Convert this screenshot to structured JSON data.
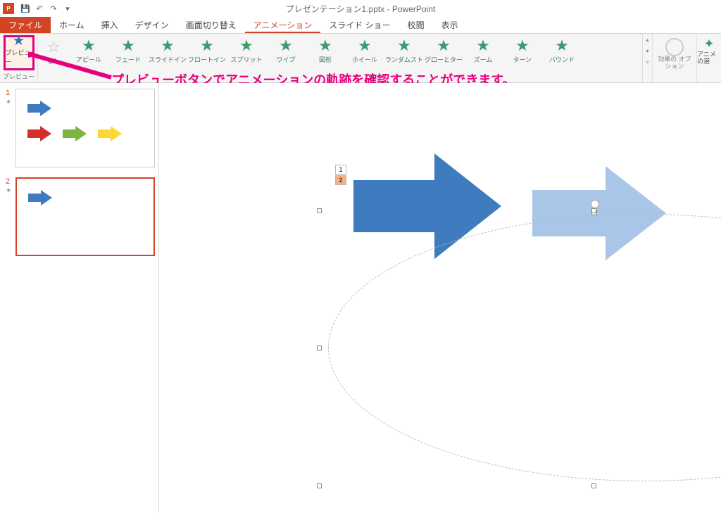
{
  "app": {
    "title": "プレゼンテーション1.pptx - PowerPoint",
    "app_abbrev": "P"
  },
  "qat": {
    "save_icon": "save-icon",
    "undo_icon": "undo-icon",
    "redo_icon": "redo-icon",
    "dropdown_icon": "chevron-down-icon"
  },
  "tabs": {
    "file": "ファイル",
    "home": "ホーム",
    "insert": "挿入",
    "design": "デザイン",
    "transitions": "画面切り替え",
    "animations": "アニメーション",
    "slideshow": "スライド ショー",
    "review": "校閲",
    "view": "表示"
  },
  "ribbon": {
    "preview_label": "プレビュー",
    "preview_group": "プレビュー",
    "none_label": "なし",
    "gallery": [
      {
        "label": "アピール"
      },
      {
        "label": "フェード"
      },
      {
        "label": "スライドイン"
      },
      {
        "label": "フロートイン"
      },
      {
        "label": "スプリット"
      },
      {
        "label": "ワイプ"
      },
      {
        "label": "図形"
      },
      {
        "label": "ホイール"
      },
      {
        "label": "ランダムスト…"
      },
      {
        "label": "グローとターン"
      },
      {
        "label": "ズーム"
      },
      {
        "label": "ターン"
      },
      {
        "label": "バウンド"
      }
    ],
    "effect_options": "効果の\nオプション",
    "anim_select": "アニメ\nの選"
  },
  "annotation": "プレビューボタンでアニメーションの軌跡を確認することができます。",
  "thumbnails": [
    {
      "num": "1",
      "has_anim": true,
      "selected": false
    },
    {
      "num": "2",
      "has_anim": true,
      "selected": true
    }
  ],
  "slide": {
    "tags": [
      "1",
      "2"
    ],
    "arrow1_color": "#3f7bbf",
    "arrow2_color": "#a9c5e8"
  }
}
